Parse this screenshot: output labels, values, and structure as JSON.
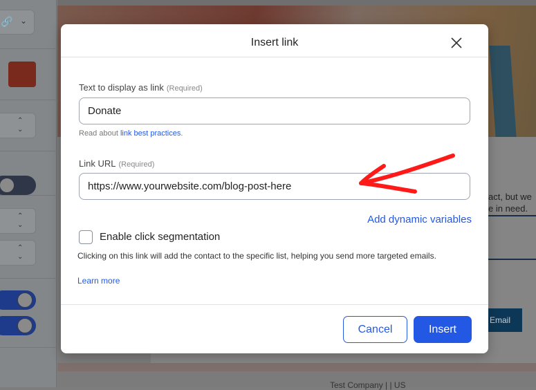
{
  "dialog": {
    "title": "Insert link",
    "text_label": "Text to display as link",
    "required": "(Required)",
    "text_value": "Donate",
    "help_prefix": "Read about ",
    "help_link": "link best practices",
    "help_suffix": ".",
    "url_label": "Link URL",
    "url_value": "https://www.yourwebsite.com/blog-post-here",
    "dynamic_variables": "Add dynamic variables",
    "segmentation_label": "Enable click segmentation",
    "segmentation_checked": false,
    "segmentation_desc": "Clicking on this link will add the contact to the specific list, helping you send more targeted emails.",
    "learn_more": "Learn more",
    "cancel": "Cancel",
    "insert": "Insert"
  },
  "background": {
    "content_line1": "act, but we",
    "content_line2": "e in need.",
    "email_button": "is Email",
    "footer": "Test Company | |   US"
  },
  "colors": {
    "accent": "#2358e5",
    "annotation": "#ff1a1a",
    "swatch": "#7a2a1c"
  }
}
